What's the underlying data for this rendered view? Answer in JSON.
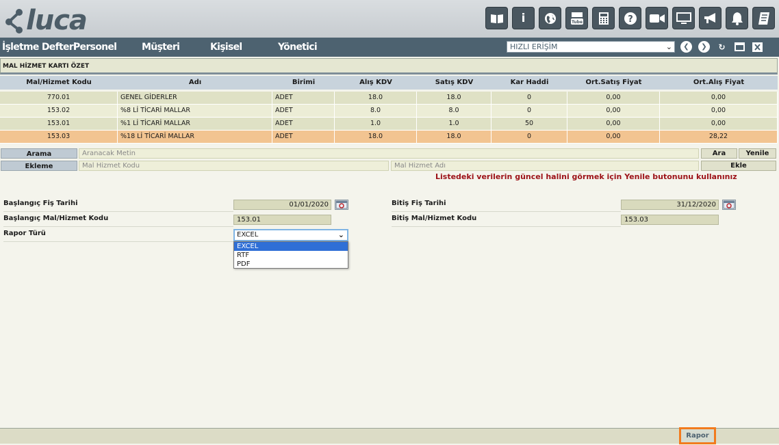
{
  "header": {
    "logo_text": "luca",
    "icons": [
      "book-icon",
      "info-icon",
      "globe-icon",
      "youtube-icon",
      "calculator-icon",
      "help-icon",
      "video-icon",
      "monitor-icon",
      "megaphone-icon",
      "bell-icon",
      "notebook-icon"
    ]
  },
  "menu": {
    "items": [
      "İşletme Defteri",
      "Personel",
      "Müşteri",
      "Kişisel",
      "Yönetici"
    ],
    "quick_access": "HIZLI ERİŞİM"
  },
  "section": {
    "title": "MAL HİZMET KARTI ÖZET"
  },
  "table": {
    "headers": [
      "Mal/Hizmet Kodu",
      "Adı",
      "Birimi",
      "Alış KDV",
      "Satış KDV",
      "Kar Haddi",
      "Ort.Satış Fiyat",
      "Ort.Alış Fiyat"
    ],
    "rows": [
      [
        "770.01",
        "GENEL GİDERLER",
        "ADET",
        "18.0",
        "18.0",
        "0",
        "0,00",
        "0,00"
      ],
      [
        "153.02",
        "%8 Lİ TİCARİ MALLAR",
        "ADET",
        "8.0",
        "8.0",
        "0",
        "0,00",
        "0,00"
      ],
      [
        "153.01",
        "%1 Lİ TİCARİ MALLAR",
        "ADET",
        "1.0",
        "1.0",
        "50",
        "0,00",
        "0,00"
      ],
      [
        "153.03",
        "%18 Lİ TİCARİ MALLAR",
        "ADET",
        "18.0",
        "18.0",
        "0",
        "0,00",
        "28,22"
      ]
    ],
    "row_colors": [
      "#dfe1c5",
      "#ecedd6",
      "#dfe1c5",
      "#f2c491"
    ]
  },
  "search": {
    "label": "Arama",
    "placeholder": "Aranacak Metin",
    "search_button": "Ara",
    "refresh_button": "Yenile"
  },
  "add": {
    "label": "Ekleme",
    "code_placeholder": "Mal Hizmet Kodu",
    "name_placeholder": "Mal Hizmet Adı",
    "add_button": "Ekle"
  },
  "notice": "Listedeki verilerin güncel halini görmek için Yenile butonunu kullanınız",
  "form": {
    "start_date_label": "Başlangıç Fiş Tarihi",
    "start_date": "01/01/2020",
    "end_date_label": "Bitiş Fiş Tarihi",
    "end_date": "31/12/2020",
    "start_code_label": "Başlangıç Mal/Hizmet Kodu",
    "start_code": "153.01",
    "end_code_label": "Bitiş Mal/Hizmet Kodu",
    "end_code": "153.03",
    "report_type_label": "Rapor Türü",
    "report_type": "EXCEL",
    "report_options": [
      "EXCEL",
      "RTF",
      "PDF"
    ]
  },
  "footer": {
    "report_button": "Rapor"
  },
  "colors": {
    "menu_bar": "#4d6270",
    "highlight_row": "#f2c491",
    "notice": "#9c1117",
    "report_border": "#f27b1d"
  }
}
